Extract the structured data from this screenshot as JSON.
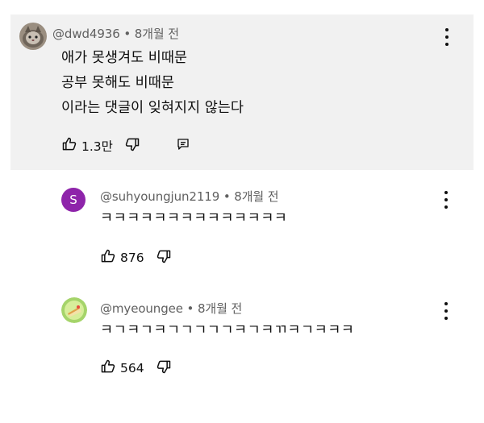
{
  "comments": [
    {
      "author": "@dwd4936",
      "time": "8개월 전",
      "avatar_icon": "cat-photo-avatar",
      "lines": [
        "애가 못생겨도 비때문",
        "공부 못해도 비때문",
        "이라는 댓글이 잊혀지지 않는다"
      ],
      "likes": "1.3만"
    },
    {
      "author": "@suhyoungjun2119",
      "time": "8개월 전",
      "avatar_letter": "S",
      "avatar_color": "#8e24aa",
      "lines": [
        "ㅋㅋㅋㅋㅋㅋㅋㅋㅋㅋㅋㅋㅋㅋ"
      ],
      "likes": "876"
    },
    {
      "author": "@myeoungee",
      "time": "8개월 전",
      "avatar_icon": "cake-avatar",
      "lines": [
        "ㅋㄱㅋㄱㅋㄱㄱㄱㄱㄱㅋㄱㅋㄲㅋㄱㅋㅋㅋ"
      ],
      "likes": "564"
    }
  ],
  "separator": " • "
}
